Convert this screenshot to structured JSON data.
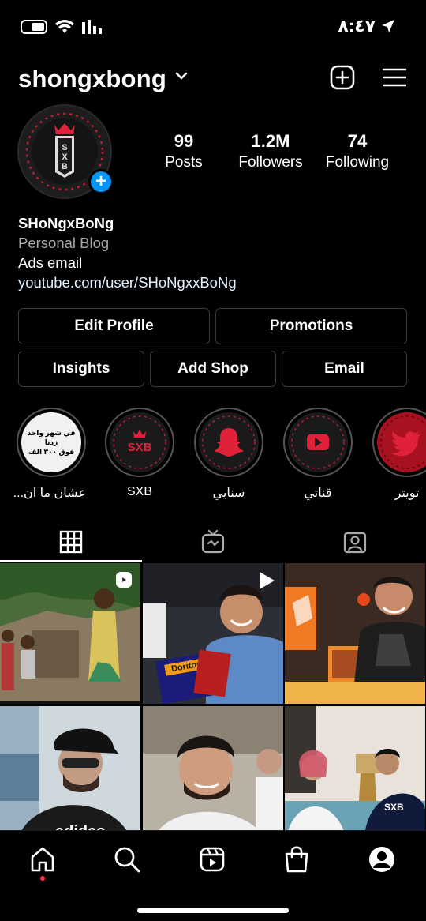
{
  "status_bar": {
    "time": "٨:٤٧"
  },
  "header": {
    "username": "shongxbong"
  },
  "profile": {
    "stats": [
      {
        "value": "99",
        "label": "Posts"
      },
      {
        "value": "1.2M",
        "label": "Followers"
      },
      {
        "value": "74",
        "label": "Following"
      }
    ],
    "name": "SHoNgxBoNg",
    "category": "Personal Blog",
    "bio_line": "Ads email",
    "link": "youtube.com/user/SHoNgxxBoNg",
    "avatar_text": "SXB"
  },
  "buttons": {
    "edit_profile": "Edit Profile",
    "promotions": "Promotions",
    "insights": "Insights",
    "add_shop": "Add Shop",
    "email": "Email"
  },
  "highlights": [
    {
      "label": "عشان ما ان...",
      "icon": "text-story",
      "story_text_1": "في شهر واحد زدنا",
      "story_text_2": "فوق ٣٠٠ الف"
    },
    {
      "label": "SXB",
      "icon": "sxb-logo",
      "logo_text": "SXB"
    },
    {
      "label": "سنابي",
      "icon": "snapchat-icon"
    },
    {
      "label": "قناتي",
      "icon": "youtube-icon"
    },
    {
      "label": "تويتر",
      "icon": "twitter-icon"
    }
  ],
  "grid": {
    "posts": [
      {
        "scene": "children-outdoors",
        "badge": "reels-icon"
      },
      {
        "scene": "man-with-snacks",
        "badge": "play-icon",
        "snack_label": "Doritos"
      },
      {
        "scene": "man-with-orange-box",
        "badge": ""
      },
      {
        "scene": "man-in-cap",
        "badge": "",
        "shirt_text": "adidas"
      },
      {
        "scene": "man-in-white-robe",
        "badge": ""
      },
      {
        "scene": "two-men-sofa",
        "badge": "",
        "shirt_text": "SXB"
      }
    ]
  },
  "colors": {
    "accent_blue": "#0095f6",
    "brand_red": "#e0213a",
    "notification_dot": "#ff3040"
  }
}
